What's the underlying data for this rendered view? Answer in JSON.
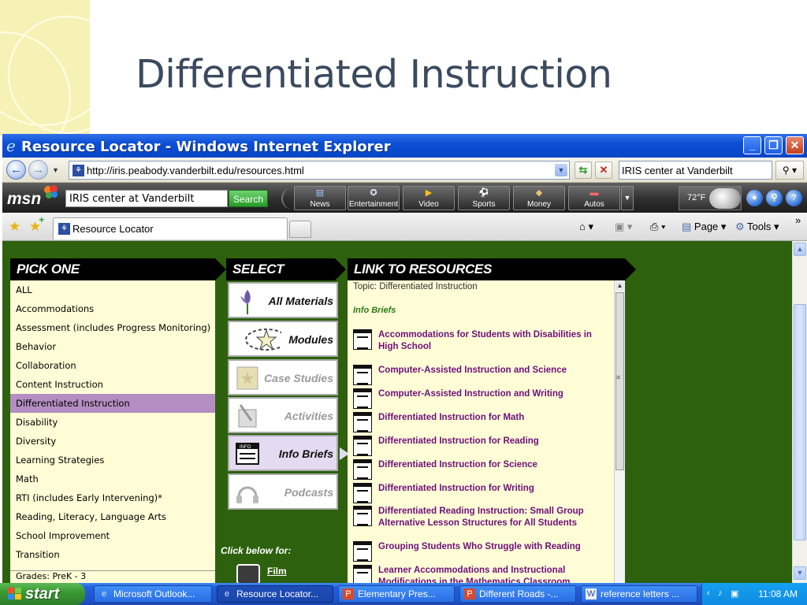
{
  "slide": {
    "title": "Differentiated Instruction"
  },
  "window": {
    "title": "Resource Locator - Windows Internet Explorer",
    "address": "http://iris.peabody.vanderbilt.edu/resources.html",
    "search_value": "IRIS center at Vanderbilt"
  },
  "msn": {
    "logo": "msn",
    "search_value": "IRIS center at Vanderbilt",
    "search_button": "Search",
    "tabs": [
      {
        "label": "News"
      },
      {
        "label": "Entertainment"
      },
      {
        "label": "Video"
      },
      {
        "label": "Sports"
      },
      {
        "label": "Money"
      },
      {
        "label": "Autos"
      }
    ],
    "weather": "72°F"
  },
  "tabs": {
    "active": "Resource Locator",
    "page_menu": "Page",
    "tools_menu": "Tools"
  },
  "panel": {
    "pick_header": "PICK ONE",
    "select_header": "SELECT",
    "link_header": "LINK TO RESOURCES",
    "topics": [
      {
        "label": "ALL"
      },
      {
        "label": "Accommodations"
      },
      {
        "label": "Assessment (includes Progress Monitoring)"
      },
      {
        "label": "Behavior"
      },
      {
        "label": "Collaboration"
      },
      {
        "label": "Content Instruction"
      },
      {
        "label": "Differentiated Instruction"
      },
      {
        "label": "Disability"
      },
      {
        "label": "Diversity"
      },
      {
        "label": "Learning Strategies"
      },
      {
        "label": "Math"
      },
      {
        "label": "RTI (includes Early Intervening)*"
      },
      {
        "label": "Reading, Literacy, Language Arts"
      },
      {
        "label": "School Improvement"
      },
      {
        "label": "Transition"
      }
    ],
    "topics_more": "Grades: PreK - 3",
    "select_items": [
      {
        "label": "All Materials"
      },
      {
        "label": "Modules"
      },
      {
        "label": "Case Studies"
      },
      {
        "label": "Activities"
      },
      {
        "label": "Info Briefs"
      },
      {
        "label": "Podcasts"
      }
    ],
    "click_below": "Click below for:",
    "film_link": "Film",
    "topic_line": "Topic: Differentiated Instruction",
    "section_heading": "Info Briefs",
    "resources": [
      {
        "title": "Accommodations for Students with Disabilities in High School"
      },
      {
        "title": "Computer-Assisted Instruction and Science"
      },
      {
        "title": "Computer-Assisted Instruction and Writing"
      },
      {
        "title": "Differentiated Instruction for Math"
      },
      {
        "title": "Differentiated Instruction for Reading"
      },
      {
        "title": "Differentiated Instruction for Science"
      },
      {
        "title": "Differentiated Instruction for Writing"
      },
      {
        "title": "Differentiated Reading Instruction: Small Group Alternative Lesson Structures for All Students"
      },
      {
        "title": "Grouping Students Who Struggle with Reading"
      },
      {
        "title": "Learner Accommodations and Instructional Modifications in the Mathematics Classroom"
      }
    ]
  },
  "taskbar": {
    "start": "start",
    "items": [
      {
        "label": "Microsoft Outlook..."
      },
      {
        "label": "Resource Locator..."
      },
      {
        "label": "Elementary Pres..."
      },
      {
        "label": "Different Roads -..."
      },
      {
        "label": "reference letters ..."
      }
    ],
    "clock": "11:08 AM"
  },
  "colors": {
    "page_bg": "#2d610e",
    "panel_bg": "#fffdd6",
    "selected_topic": "#b48ec2",
    "link_color": "#6e0f79",
    "title_color": "#3b4a5e"
  }
}
